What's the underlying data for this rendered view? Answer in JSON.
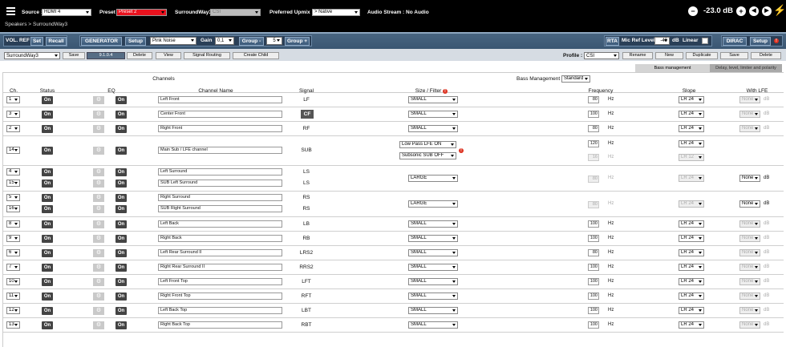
{
  "top": {
    "source_label": "Source :",
    "source_value": "HDMI 4",
    "preset_label": "Preset :",
    "preset_value": "Preset 2",
    "surround_label": "SurroundWay3 :",
    "surround_value": "CSI",
    "upmix_label": "Preferred Upmix :",
    "upmix_value": "> Native",
    "audio_stream": "Audio Stream : No Audio",
    "volume": "-23.0 dB",
    "minus": "−",
    "plus": "+",
    "speaker": "◀",
    "play": "▶",
    "bolt": "⚡",
    "breadcrumb_1": "Speakers >",
    "breadcrumb_2": "SurroundWay3"
  },
  "toolbar": {
    "vol_ref": "VOL. REF",
    "set": "Set",
    "recall": "Recall",
    "generator": "GENERATOR",
    "setup": "Setup",
    "noise": "Pink Noise",
    "gain_label": "Gain",
    "gain_value": "0,1",
    "group_minus": "Group -",
    "group_value": "5",
    "group_plus": "Group +",
    "rta": "RTA",
    "mic_ref": "Mic Ref Level",
    "mic_value": "-40",
    "db": "dB",
    "linear": "Linear",
    "dirac": "DIRAC",
    "dirac_setup": "Setup",
    "badge": "!"
  },
  "subbar": {
    "name_value": "SurroundWay3",
    "save": "Save",
    "version": "9.1.0.4",
    "delete": "Delete",
    "view": "View",
    "signal_routing": "Signal Routing",
    "create_child": "Create Child",
    "profile_label": "Profile :",
    "profile_value": "CSI",
    "rename": "Rename",
    "new": "New",
    "duplicate": "Duplicate",
    "save2": "Save",
    "delete2": "Delete"
  },
  "tabs": {
    "bass": "Bass management",
    "delay": "Delay, level, limiter and polarity"
  },
  "grid": {
    "channels_title": "Channels",
    "bass_mgmt_label": "Bass Management",
    "bass_mgmt_value": "Standard",
    "cols": {
      "ch": "Ch.",
      "status": "Status",
      "eq": "EQ",
      "name": "Channel Name",
      "signal": "Signal",
      "size": "Size / Filter",
      "freq": "Frequency",
      "slope": "Slope",
      "lfe": "With LFE"
    },
    "on": "On",
    "gear": "⚙",
    "hz": "Hz",
    "db": "dB",
    "rows": [
      {
        "ch": "1",
        "name": "Left Front",
        "signal": "LF",
        "size": "SMALL",
        "freq": "80",
        "slope": "LR 24",
        "lfe": "None",
        "lfe_db": "dB"
      },
      {
        "ch": "3",
        "name": "Center Front",
        "signal": "CF",
        "size": "SMALL",
        "freq": "100",
        "slope": "LR 24",
        "lfe": "None",
        "lfe_db": "dB"
      },
      {
        "ch": "2",
        "name": "Right Front",
        "signal": "RF",
        "size": "SMALL",
        "freq": "80",
        "slope": "LR 24",
        "lfe": "None",
        "lfe_db": "dB"
      },
      {
        "ch": "14",
        "name": "Main Sub / LFE channel",
        "signal": "SUB",
        "size": "Low Pass LFE ON",
        "size2": "Subsonic SUB OFF",
        "freq": "120",
        "freq2": "16",
        "slope": "LR 24",
        "slope2": "LR 12"
      },
      {
        "ch": "4",
        "ch2": "15",
        "name": "Left Surround",
        "name2": "SUB Left Surround",
        "signal": "LS",
        "signal2": "LS",
        "size": "LARGE",
        "freq": "80",
        "slope": "LR 24",
        "lfe": "None",
        "lfe_db": "dB"
      },
      {
        "ch": "5",
        "ch2": "16",
        "name": "Right Surround",
        "name2": "SUB Right Surround",
        "signal": "RS",
        "signal2": "RS",
        "size": "LARGE",
        "freq": "80",
        "slope": "LR 24",
        "lfe": "None",
        "lfe_db": "dB"
      },
      {
        "ch": "8",
        "name": "Left Back",
        "signal": "LB",
        "size": "SMALL",
        "freq": "100",
        "slope": "LR 24",
        "lfe": "None",
        "lfe_db": "dB"
      },
      {
        "ch": "9",
        "name": "Right Back",
        "signal": "RB",
        "size": "SMALL",
        "freq": "100",
        "slope": "LR 24",
        "lfe": "None",
        "lfe_db": "dB"
      },
      {
        "ch": "6",
        "name": "Left Rear Surround II",
        "signal": "LRS2",
        "size": "SMALL",
        "freq": "80",
        "slope": "LR 24",
        "lfe": "None",
        "lfe_db": "dB"
      },
      {
        "ch": "7",
        "name": "Right Rear Surround II",
        "signal": "RRS2",
        "size": "SMALL",
        "freq": "100",
        "slope": "LR 24",
        "lfe": "None",
        "lfe_db": "dB"
      },
      {
        "ch": "10",
        "name": "Left Front Top",
        "signal": "LFT",
        "size": "SMALL",
        "freq": "100",
        "slope": "LR 24",
        "lfe": "None",
        "lfe_db": "dB"
      },
      {
        "ch": "11",
        "name": "Right Front Top",
        "signal": "RFT",
        "size": "SMALL",
        "freq": "100",
        "slope": "LR 24",
        "lfe": "None",
        "lfe_db": "dB"
      },
      {
        "ch": "12",
        "name": "Left Back Top",
        "signal": "LBT",
        "size": "SMALL",
        "freq": "100",
        "slope": "LR 24",
        "lfe": "None",
        "lfe_db": "dB"
      },
      {
        "ch": "13",
        "name": "Right Back Top",
        "signal": "RBT",
        "size": "SMALL",
        "freq": "100",
        "slope": "LR 24",
        "lfe": "None",
        "lfe_db": "dB"
      }
    ]
  }
}
